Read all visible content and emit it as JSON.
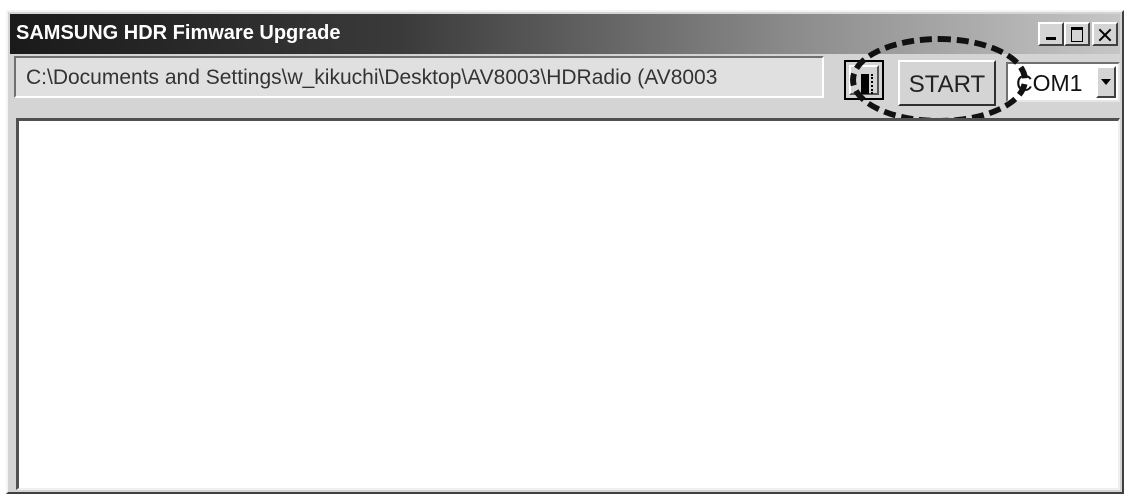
{
  "window": {
    "title": "SAMSUNG HDR Fimware Upgrade",
    "controls": [
      "minimize",
      "maximize",
      "close"
    ]
  },
  "toolbar": {
    "file_path": "C:\\Documents and Settings\\w_kikuchi\\Desktop\\AV8003\\HDRadio (AV8003",
    "browse_icon": "browse-folder-icon",
    "start_label": "START",
    "port_selected": "COM1"
  },
  "log": {
    "content": ""
  }
}
